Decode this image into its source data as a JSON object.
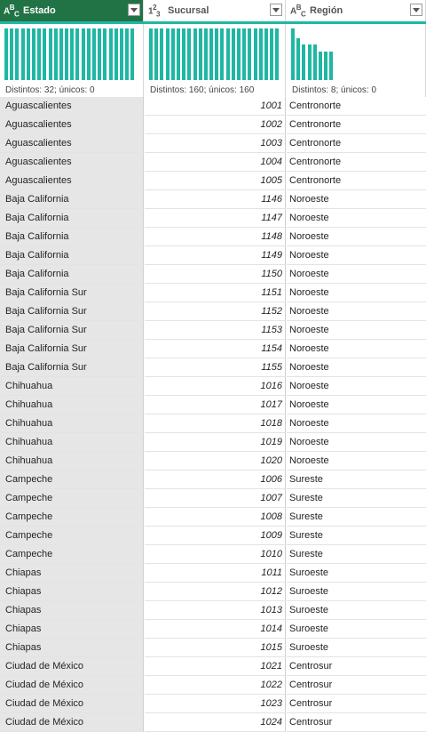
{
  "columns": [
    {
      "type_icon": "ABC",
      "title": "Estado",
      "stat": "Distintos: 32; únicos: 0",
      "bars": [
        1,
        1,
        1,
        1,
        1,
        1,
        1,
        1,
        1,
        1,
        1,
        1,
        1,
        1,
        1,
        1,
        1,
        1,
        1,
        1,
        1,
        1,
        1,
        1
      ]
    },
    {
      "type_icon": "123",
      "title": "Sucursal",
      "stat": "Distintos: 160; únicos: 160",
      "bars": [
        1,
        1,
        1,
        1,
        1,
        1,
        1,
        1,
        1,
        1,
        1,
        1,
        1,
        1,
        1,
        1,
        1,
        1,
        1,
        1,
        1,
        1,
        1,
        1
      ]
    },
    {
      "type_icon": "ABC",
      "title": "Región",
      "stat": "Distintos: 8; únicos: 0",
      "bars": [
        1.0,
        0.81,
        0.69,
        0.69,
        0.69,
        0.55,
        0.55,
        0.55
      ]
    }
  ],
  "dropdown_icon": "chevron-down-icon",
  "accent_color": "#1fb7a3",
  "header_active_color": "#217346",
  "rows": [
    [
      "Aguascalientes",
      "1001",
      "Centronorte"
    ],
    [
      "Aguascalientes",
      "1002",
      "Centronorte"
    ],
    [
      "Aguascalientes",
      "1003",
      "Centronorte"
    ],
    [
      "Aguascalientes",
      "1004",
      "Centronorte"
    ],
    [
      "Aguascalientes",
      "1005",
      "Centronorte"
    ],
    [
      "Baja California",
      "1146",
      "Noroeste"
    ],
    [
      "Baja California",
      "1147",
      "Noroeste"
    ],
    [
      "Baja California",
      "1148",
      "Noroeste"
    ],
    [
      "Baja California",
      "1149",
      "Noroeste"
    ],
    [
      "Baja California",
      "1150",
      "Noroeste"
    ],
    [
      "Baja California Sur",
      "1151",
      "Noroeste"
    ],
    [
      "Baja California Sur",
      "1152",
      "Noroeste"
    ],
    [
      "Baja California Sur",
      "1153",
      "Noroeste"
    ],
    [
      "Baja California Sur",
      "1154",
      "Noroeste"
    ],
    [
      "Baja California Sur",
      "1155",
      "Noroeste"
    ],
    [
      "Chihuahua",
      "1016",
      "Noroeste"
    ],
    [
      "Chihuahua",
      "1017",
      "Noroeste"
    ],
    [
      "Chihuahua",
      "1018",
      "Noroeste"
    ],
    [
      "Chihuahua",
      "1019",
      "Noroeste"
    ],
    [
      "Chihuahua",
      "1020",
      "Noroeste"
    ],
    [
      "Campeche",
      "1006",
      "Sureste"
    ],
    [
      "Campeche",
      "1007",
      "Sureste"
    ],
    [
      "Campeche",
      "1008",
      "Sureste"
    ],
    [
      "Campeche",
      "1009",
      "Sureste"
    ],
    [
      "Campeche",
      "1010",
      "Sureste"
    ],
    [
      "Chiapas",
      "1011",
      "Suroeste"
    ],
    [
      "Chiapas",
      "1012",
      "Suroeste"
    ],
    [
      "Chiapas",
      "1013",
      "Suroeste"
    ],
    [
      "Chiapas",
      "1014",
      "Suroeste"
    ],
    [
      "Chiapas",
      "1015",
      "Suroeste"
    ],
    [
      "Ciudad de México",
      "1021",
      "Centrosur"
    ],
    [
      "Ciudad de México",
      "1022",
      "Centrosur"
    ],
    [
      "Ciudad de México",
      "1023",
      "Centrosur"
    ],
    [
      "Ciudad de México",
      "1024",
      "Centrosur"
    ]
  ]
}
